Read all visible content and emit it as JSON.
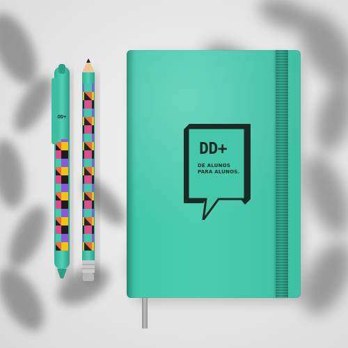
{
  "scene": {
    "description_free": true,
    "colors": {
      "background": "#e9e9e9",
      "teal": "#45c8aa",
      "teal_dark": "#1d8a71",
      "logo_ink": "#1a2b26"
    }
  },
  "notebook": {
    "logo": {
      "title": "DD+",
      "tagline_line1": "DE ALUNOS",
      "tagline_line2": "PARA ALUNOS."
    }
  },
  "pen": {
    "cap_label": "DD+"
  },
  "icons": [
    "speech-bubble-logo-icon"
  ]
}
